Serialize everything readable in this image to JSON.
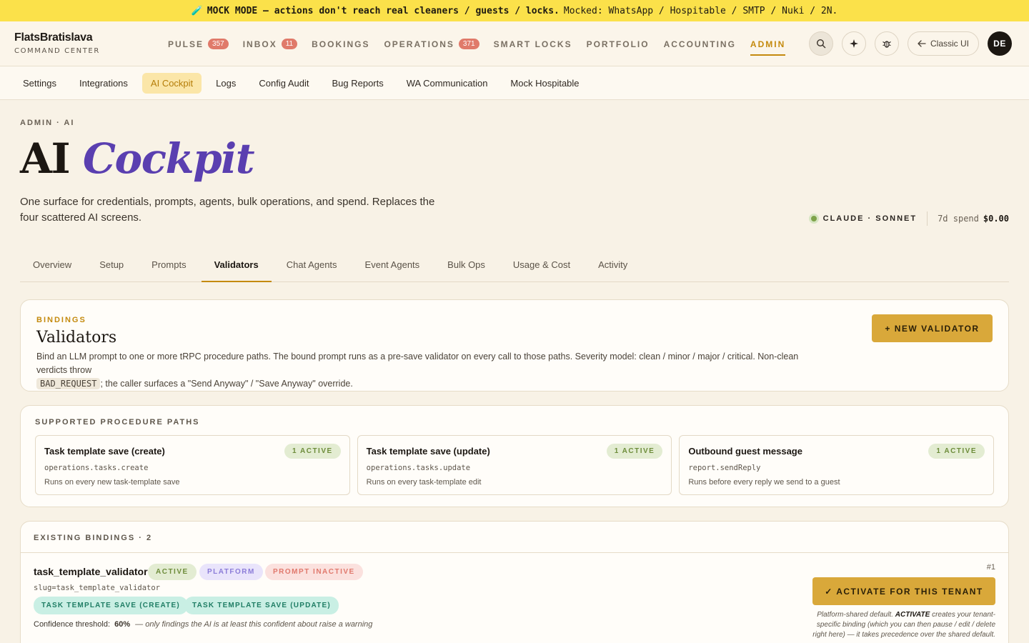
{
  "banner": {
    "emoji": "🧪",
    "bold": "MOCK MODE — actions don't reach real cleaners / guests / locks.",
    "rest": "Mocked: WhatsApp / Hospitable / SMTP / Nuki / 2N."
  },
  "brand": {
    "name": "FlatsBratislava",
    "sub": "COMMAND CENTER"
  },
  "nav": [
    {
      "label": "PULSE",
      "badge": "357"
    },
    {
      "label": "INBOX",
      "badge": "11"
    },
    {
      "label": "BOOKINGS"
    },
    {
      "label": "OPERATIONS",
      "badge": "371"
    },
    {
      "label": "SMART LOCKS"
    },
    {
      "label": "PORTFOLIO"
    },
    {
      "label": "ACCOUNTING"
    },
    {
      "label": "ADMIN",
      "active": true
    }
  ],
  "tools": {
    "classic_label": "Classic UI",
    "avatar_initials": "DE"
  },
  "subnav": [
    "Settings",
    "Integrations",
    "AI Cockpit",
    "Logs",
    "Config Audit",
    "Bug Reports",
    "WA Communication",
    "Mock Hospitable"
  ],
  "page": {
    "eyebrow": "ADMIN · AI",
    "title_plain": "AI",
    "title_italic": "Cockpit",
    "description": "One surface for credentials, prompts, agents, bulk operations, and spend. Replaces the four scattered AI screens.",
    "model": "CLAUDE · SONNET",
    "spend_label": "7d spend",
    "spend_value": "$0.00"
  },
  "tabs": [
    "Overview",
    "Setup",
    "Prompts",
    "Validators",
    "Chat Agents",
    "Event Agents",
    "Bulk Ops",
    "Usage & Cost",
    "Activity"
  ],
  "bindings_card": {
    "kicker": "BINDINGS",
    "title": "Validators",
    "desc_part1": "Bind an LLM prompt to one or more tRPC procedure paths. The bound prompt runs as a pre-save validator on every call to those paths. Severity model: clean / minor / major / critical. Non-clean verdicts throw",
    "desc_code": "BAD_REQUEST",
    "desc_part2": "; the caller surfaces a \"Send Anyway\" / \"Save Anyway\" override.",
    "new_button": "+ NEW VALIDATOR"
  },
  "supported": {
    "kicker": "SUPPORTED PROCEDURE PATHS",
    "paths": [
      {
        "title": "Task template save (create)",
        "badge": "1 ACTIVE",
        "code": "operations.tasks.create",
        "desc": "Runs on every new task-template save"
      },
      {
        "title": "Task template save (update)",
        "badge": "1 ACTIVE",
        "code": "operations.tasks.update",
        "desc": "Runs on every task-template edit"
      },
      {
        "title": "Outbound guest message",
        "badge": "1 ACTIVE",
        "code": "report.sendReply",
        "desc": "Runs before every reply we send to a guest"
      }
    ]
  },
  "existing": {
    "kicker": "EXISTING BINDINGS · 2",
    "binding": {
      "name": "task_template_validator",
      "tag_active": "ACTIVE",
      "tag_platform": "PLATFORM",
      "tag_inactive": "PROMPT INACTIVE",
      "slug": "slug=task_template_validator",
      "proc1": "TASK TEMPLATE SAVE (CREATE)",
      "proc2": "TASK TEMPLATE SAVE (UPDATE)",
      "threshold_label": "Confidence threshold:",
      "threshold_value": "60%",
      "threshold_note": "— only findings the AI is at least this confident about raise a warning",
      "number": "#1",
      "activate_button": "✓ ACTIVATE FOR THIS TENANT",
      "note_prefix": "Platform-shared default.",
      "note_bold": "ACTIVATE",
      "note_suffix": "creates your tenant-specific binding (which you can then pause / edit / delete right here) — it takes precedence over the shared default."
    }
  },
  "colors": {
    "accent": "#c48a0e",
    "banner": "#fbe14a",
    "brand_purple": "#5a3fb0",
    "button": "#d9a83a"
  }
}
